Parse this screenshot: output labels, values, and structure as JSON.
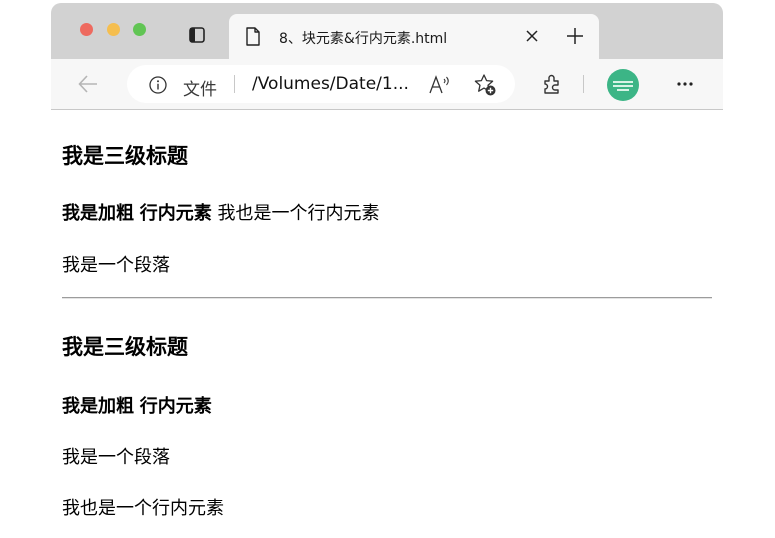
{
  "tab": {
    "title": "8、块元素&行内元素.html"
  },
  "toolbar": {
    "file_label": "文件",
    "url": "/Volumes/Date/1..."
  },
  "icons": {
    "tab_actions": "tab-actions-icon",
    "page": "page-icon",
    "close": "close-icon",
    "new_tab": "plus-icon",
    "back": "back-arrow-icon",
    "info": "info-icon",
    "read_aloud": "read-aloud-icon",
    "favorites": "add-favorite-icon",
    "extensions": "extensions-icon",
    "profile": "profile-avatar",
    "more": "more-icon"
  },
  "colors": {
    "avatar": "#3cb586",
    "traffic_red": "#ee6a5f",
    "traffic_yellow": "#f5be4f",
    "traffic_green": "#61c554"
  },
  "page": {
    "section1": {
      "heading": "我是三级标题",
      "bold1": "我是加粗",
      "bold2": "行内元素",
      "inline_text": "我也是一个行内元素",
      "paragraph": "我是一个段落"
    },
    "section2": {
      "heading": "我是三级标题",
      "bold1": "我是加粗",
      "bold2": "行内元素",
      "paragraph": "我是一个段落",
      "inline_text": "我也是一个行内元素"
    }
  }
}
